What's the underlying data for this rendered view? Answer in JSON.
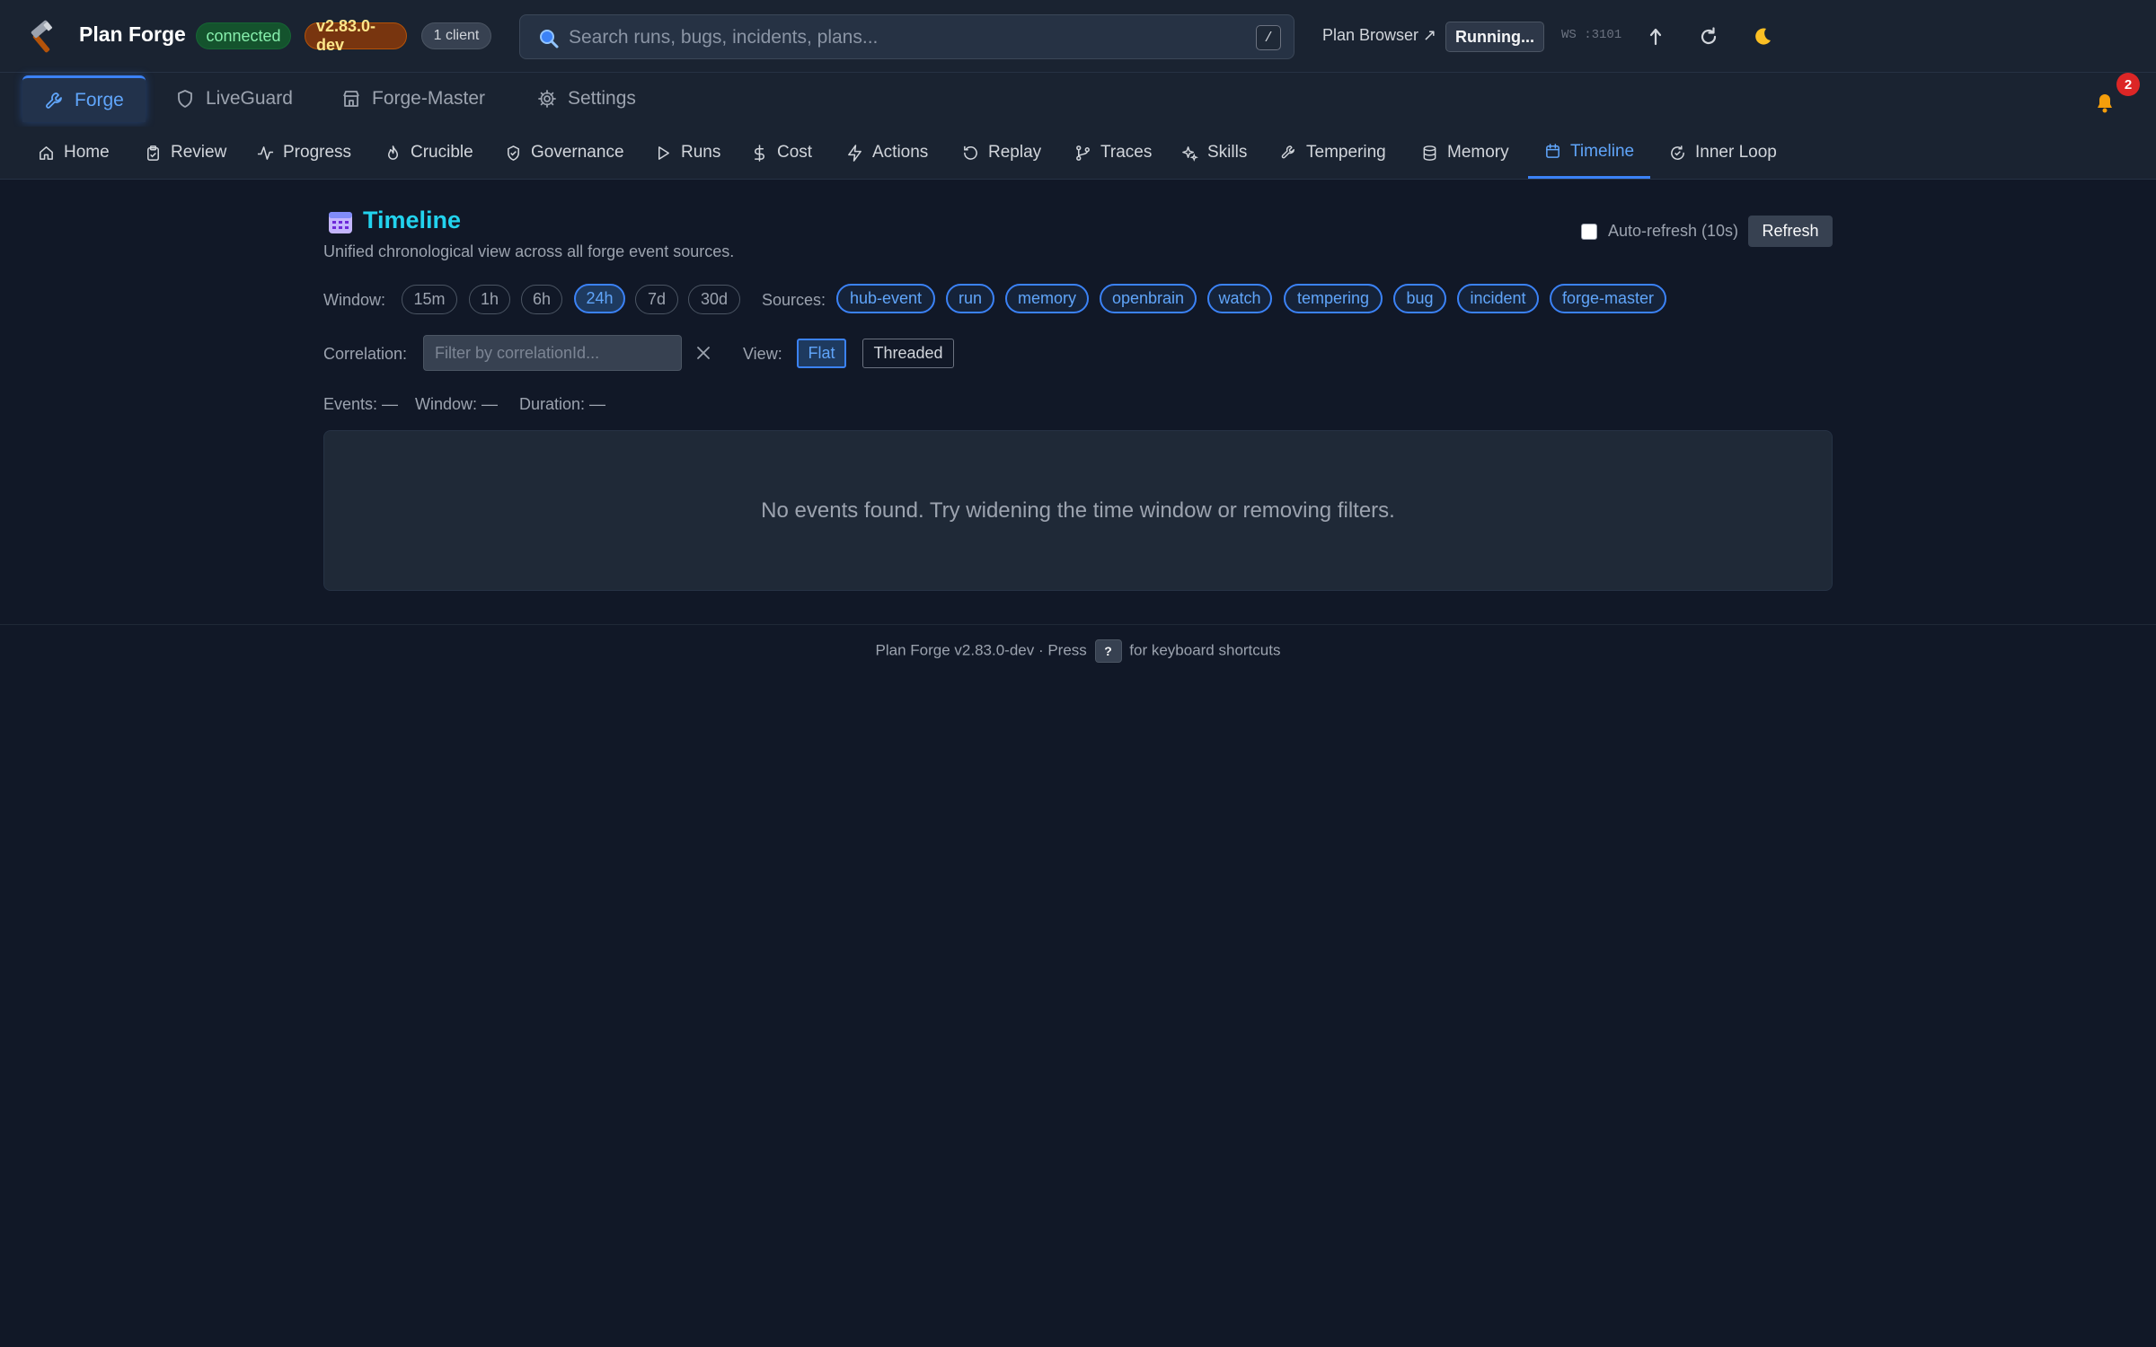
{
  "header": {
    "brand": "Plan Forge",
    "status_badge": "connected",
    "version_badge": "v2.83.0-dev",
    "clients_badge": "1 client",
    "search_placeholder": "Search runs, bugs, incidents, plans...",
    "search_shortcut": "/",
    "plan_browser": "Plan Browser ↗",
    "running_label": "Running...",
    "ws_label": "WS :3101",
    "icons": [
      "hammer-icon",
      "search-icon",
      "upload-icon",
      "refresh-icon",
      "moon-icon",
      "bell-icon"
    ]
  },
  "primary_tabs": [
    {
      "label": "Forge",
      "icon": "wrench-icon",
      "active": true
    },
    {
      "label": "LiveGuard",
      "icon": "shield-icon",
      "active": false
    },
    {
      "label": "Forge-Master",
      "icon": "store-icon",
      "active": false
    },
    {
      "label": "Settings",
      "icon": "gear-icon",
      "active": false
    }
  ],
  "notifications": {
    "count": "2"
  },
  "subnav": [
    {
      "label": "Home",
      "icon": "home-icon"
    },
    {
      "label": "Review",
      "icon": "clipboard-icon"
    },
    {
      "label": "Progress",
      "icon": "activity-icon"
    },
    {
      "label": "Crucible",
      "icon": "flame-icon"
    },
    {
      "label": "Governance",
      "icon": "shield-check-icon"
    },
    {
      "label": "Runs",
      "icon": "play-icon"
    },
    {
      "label": "Cost",
      "icon": "dollar-icon"
    },
    {
      "label": "Actions",
      "icon": "bolt-icon"
    },
    {
      "label": "Replay",
      "icon": "replay-icon"
    },
    {
      "label": "Traces",
      "icon": "git-branch-icon"
    },
    {
      "label": "Skills",
      "icon": "sparkles-icon"
    },
    {
      "label": "Tempering",
      "icon": "hammer-small-icon"
    },
    {
      "label": "Memory",
      "icon": "database-icon"
    },
    {
      "label": "Timeline",
      "icon": "calendar-icon",
      "active": true
    },
    {
      "label": "Inner Loop",
      "icon": "loop-icon"
    }
  ],
  "page": {
    "title": "Timeline",
    "subtitle": "Unified chronological view across all forge event sources.",
    "auto_refresh_label": "Auto-refresh (10s)",
    "auto_refresh_checked": false,
    "refresh_button": "Refresh"
  },
  "filters": {
    "window_label": "Window:",
    "windows": [
      "15m",
      "1h",
      "6h",
      "24h",
      "7d",
      "30d"
    ],
    "selected_window": "24h",
    "sources_label": "Sources:",
    "sources": [
      "hub-event",
      "run",
      "memory",
      "openbrain",
      "watch",
      "tempering",
      "bug",
      "incident",
      "forge-master"
    ],
    "correlation_label": "Correlation:",
    "correlation_placeholder": "Filter by correlationId...",
    "correlation_value": "",
    "view_label": "View:",
    "views": [
      "Flat",
      "Threaded"
    ],
    "selected_view": "Flat"
  },
  "stats": {
    "events": "Events: —",
    "window": "Window: —",
    "duration": "Duration: —"
  },
  "empty_message": "No events found. Try widening the time window or removing filters.",
  "footer": {
    "prefix": "Plan Forge v2.83.0-dev · Press",
    "key": "?",
    "suffix": "for keyboard shortcuts"
  },
  "colors": {
    "background": "#111827",
    "accent": "#3b82f6",
    "title": "#22d3ee",
    "connected": "#86efac",
    "version": "#fde68a"
  }
}
